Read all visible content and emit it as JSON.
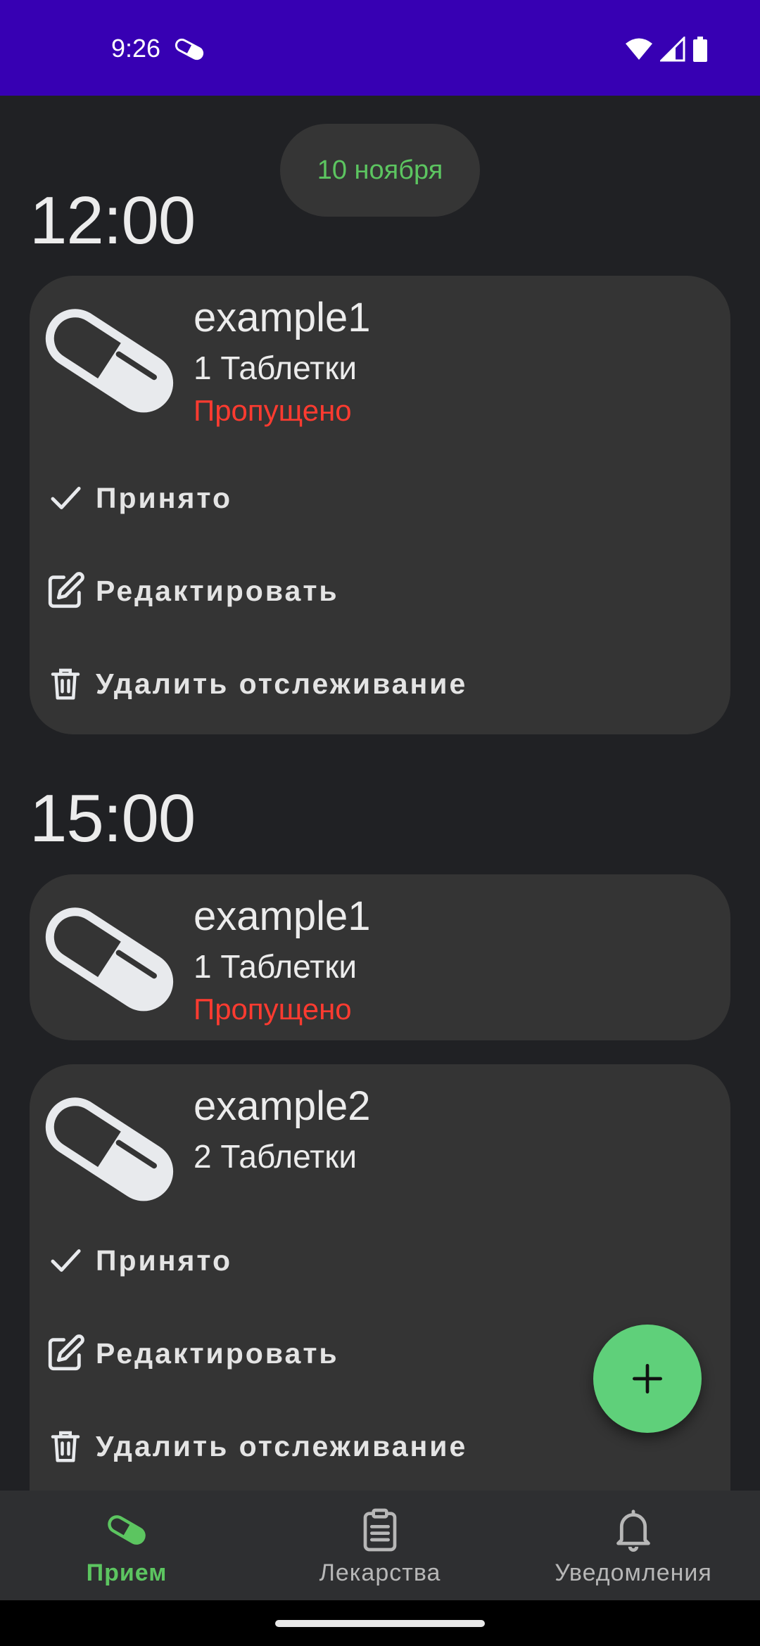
{
  "status_bar": {
    "time": "9:26",
    "app_icon": "pill-notification-icon",
    "icons": [
      "wifi-icon",
      "signal-icon",
      "battery-icon"
    ],
    "background_color": "#3700b3"
  },
  "date_chip": "10 ноября",
  "groups": [
    {
      "time": "12:00",
      "cards": [
        {
          "name": "example1",
          "dose": "1 Таблетки",
          "status": "Пропущено",
          "expanded": true
        }
      ]
    },
    {
      "time": "15:00",
      "cards": [
        {
          "name": "example1",
          "dose": "1 Таблетки",
          "status": "Пропущено",
          "expanded": false
        },
        {
          "name": "example2",
          "dose": "2 Таблетки",
          "status": "",
          "expanded": true
        }
      ]
    }
  ],
  "actions": {
    "taken": "Принято",
    "edit": "Редактировать",
    "delete": "Удалить отслеживание"
  },
  "fab": {
    "icon": "plus-icon",
    "color": "#5fd07a"
  },
  "bottom_nav": {
    "items": [
      {
        "label": "Прием",
        "icon": "pill-icon",
        "active": true
      },
      {
        "label": "Лекарства",
        "icon": "clipboard-icon",
        "active": false
      },
      {
        "label": "Уведомления",
        "icon": "bell-icon",
        "active": false
      }
    ],
    "accent_color": "#5cc560"
  },
  "colors": {
    "background": "#202124",
    "card": "#343434",
    "missed": "#ff3b30"
  }
}
